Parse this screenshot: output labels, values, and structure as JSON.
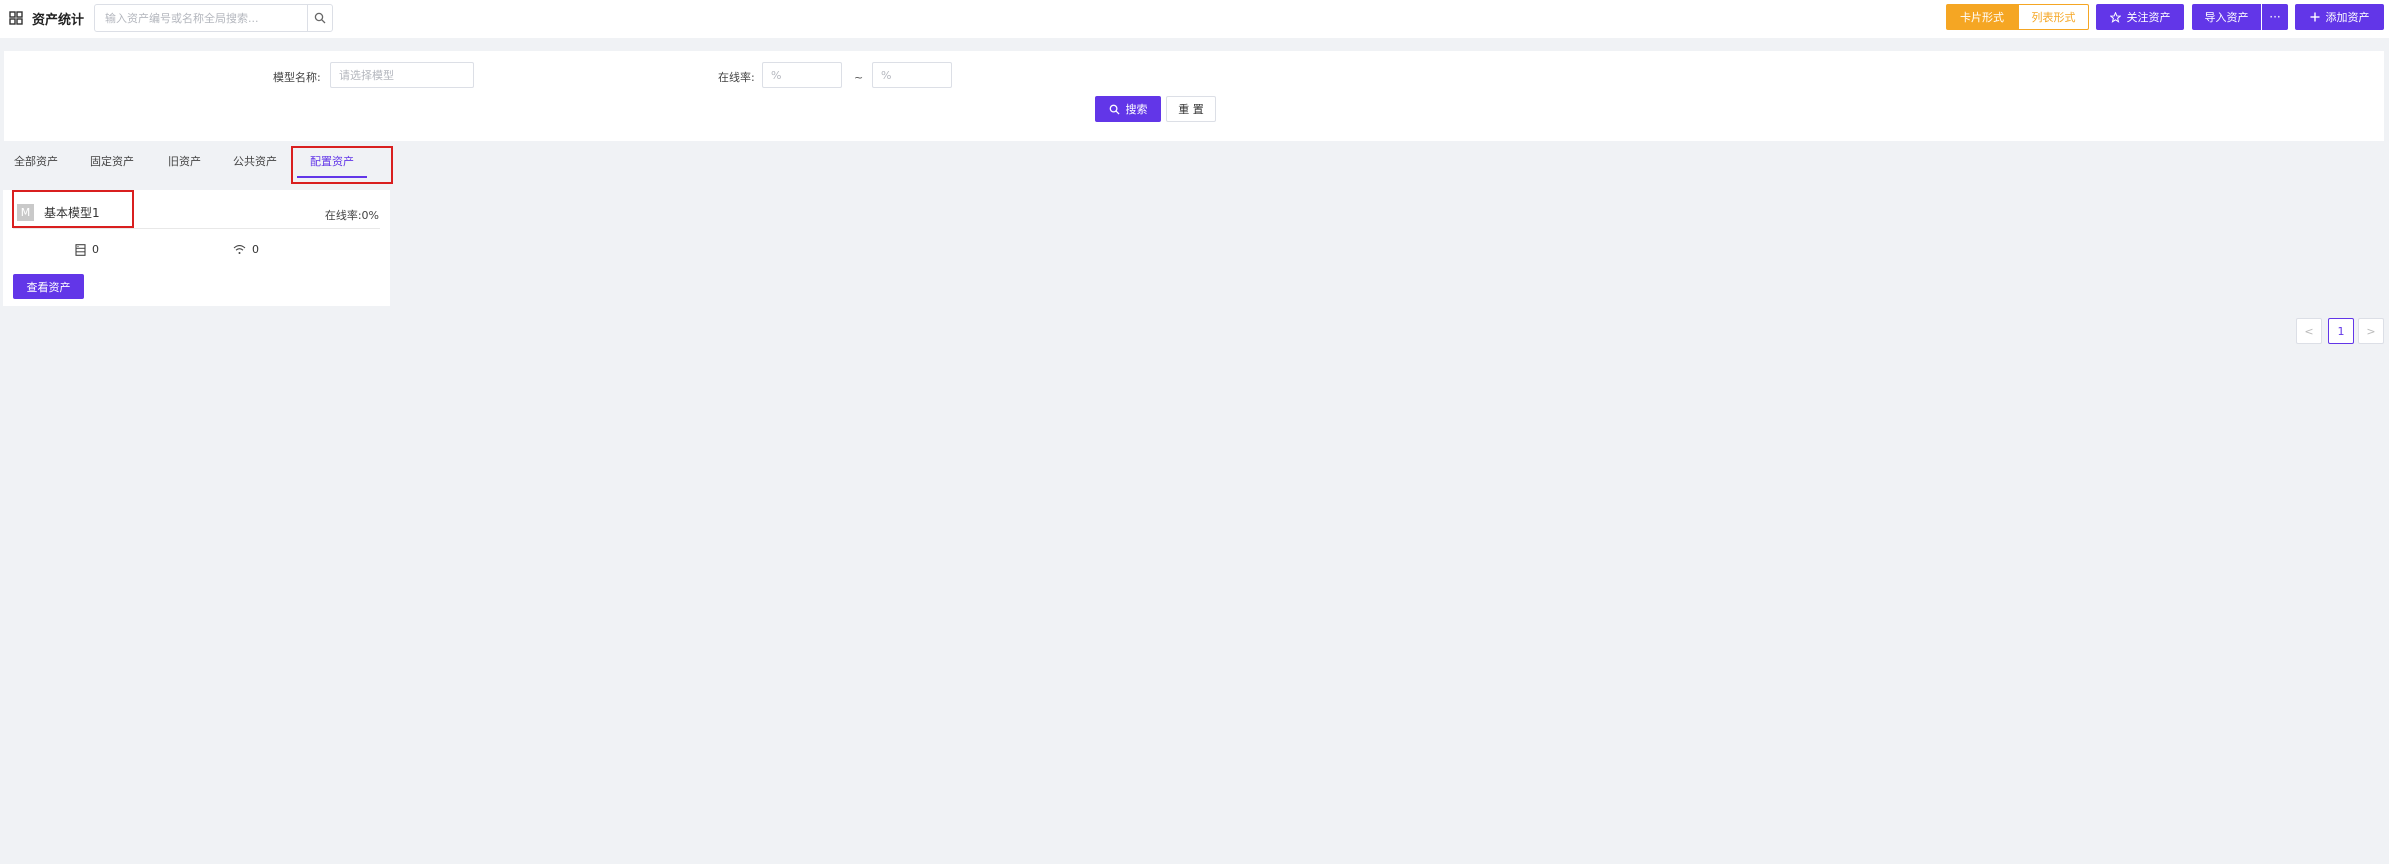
{
  "header": {
    "title": "资产统计",
    "search_placeholder": "输入资产编号或名称全局搜索...",
    "view_card_label": "卡片形式",
    "view_list_label": "列表形式",
    "follow_label": "关注资产",
    "import_label": "导入资产",
    "more_label": "···",
    "add_label": "添加资产"
  },
  "filters": {
    "model_name_label": "模型名称:",
    "model_name_placeholder": "请选择模型",
    "online_rate_label": "在线率:",
    "online_min_placeholder": "%",
    "online_max_placeholder": "%",
    "range_separator": "~",
    "search_label": "搜索",
    "reset_label": "重 置"
  },
  "tabs": [
    {
      "label": "全部资产",
      "active": false
    },
    {
      "label": "固定资产",
      "active": false
    },
    {
      "label": "旧资产",
      "active": false
    },
    {
      "label": "公共资产",
      "active": false
    },
    {
      "label": "配置资产",
      "active": true
    }
  ],
  "cards": [
    {
      "badge": "M",
      "name": "基本模型1",
      "online_rate_label": "在线率:",
      "online_rate_value": "0%",
      "device_count": "0",
      "online_count": "0",
      "view_label": "查看资产"
    }
  ],
  "pagination": {
    "prev_label": "<",
    "current_page": "1",
    "next_label": ">"
  },
  "colors": {
    "primary": "#6236e8",
    "warning": "#f5a623",
    "highlight_box": "#d91f1f"
  }
}
